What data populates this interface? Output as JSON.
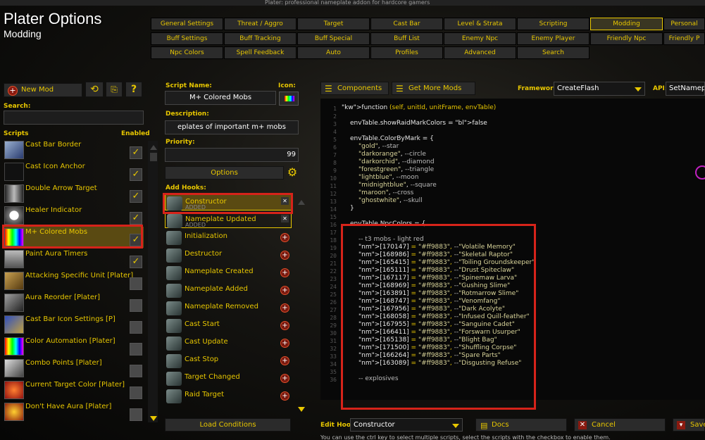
{
  "top_strip": "Plater: professional nameplate addon for hardcore gamers",
  "app": {
    "title": "Plater Options",
    "subtitle": "Modding"
  },
  "tabs": [
    [
      "General Settings",
      "Threat / Aggro",
      "Target",
      "Cast Bar",
      "Level & Strata",
      "Scripting",
      "Modding",
      "Personal"
    ],
    [
      "Buff Settings",
      "Buff Tracking",
      "Buff Special",
      "Buff List",
      "Enemy Npc",
      "Enemy Player",
      "Friendly Npc",
      "Friendly P"
    ],
    [
      "Npc Colors",
      "Spell Feedback",
      "Auto",
      "Profiles",
      "Advanced",
      "Search"
    ]
  ],
  "left": {
    "new_mod": "New Mod",
    "search_label": "Search:",
    "scripts_label": "Scripts",
    "enabled_label": "Enabled",
    "scripts": [
      {
        "name": "Cast Bar Border",
        "enabled": true
      },
      {
        "name": "Cast Icon Anchor",
        "enabled": true
      },
      {
        "name": "Double Arrow Target",
        "enabled": true
      },
      {
        "name": "Healer Indicator",
        "enabled": true
      },
      {
        "name": "M+ Colored Mobs",
        "enabled": true
      },
      {
        "name": "Paint Aura Timers",
        "enabled": true
      },
      {
        "name": "Attacking Specific Unit [Plater]",
        "enabled": false
      },
      {
        "name": "Aura Reorder [Plater]",
        "enabled": false
      },
      {
        "name": "Cast Bar Icon Settings [P]",
        "enabled": false
      },
      {
        "name": "Color Automation [Plater]",
        "enabled": false
      },
      {
        "name": "Combo Points [Plater]",
        "enabled": false
      },
      {
        "name": "Current Target Color [Plater]",
        "enabled": false
      },
      {
        "name": "Don't Have Aura [Plater]",
        "enabled": false
      }
    ],
    "check_glyph": "✓"
  },
  "middle": {
    "script_name_label": "Script Name:",
    "script_name": "M+ Colored Mobs",
    "icon_label": "Icon:",
    "description_label": "Description:",
    "description": "eplates of important m+ mobs",
    "priority_label": "Priority:",
    "priority": "99",
    "options": "Options",
    "add_hooks_label": "Add Hooks:",
    "hooks": [
      {
        "name": "Constructor",
        "sub": "ADDED"
      },
      {
        "name": "Nameplate Updated",
        "sub": "ADDED"
      },
      {
        "name": "Initialization"
      },
      {
        "name": "Destructor"
      },
      {
        "name": "Nameplate Created"
      },
      {
        "name": "Nameplate Added"
      },
      {
        "name": "Nameplate Removed"
      },
      {
        "name": "Cast Start"
      },
      {
        "name": "Cast Update"
      },
      {
        "name": "Cast Stop"
      },
      {
        "name": "Target Changed"
      },
      {
        "name": "Raid Target"
      }
    ],
    "load_conditions": "Load Conditions"
  },
  "right": {
    "components": "Components",
    "get_more_mods": "Get More Mods",
    "framework_label": "Framework:",
    "framework": "CreateFlash",
    "api_label": "API:",
    "api": "SetNameplat",
    "edit_hook_label": "Edit Hook:",
    "edit_hook": "Constructor",
    "docs": "Docs",
    "cancel": "Cancel",
    "save": "Save"
  },
  "code": {
    "line_numbers": [
      "1",
      "2",
      "3",
      "4",
      "5",
      "6",
      "7",
      "8",
      "9",
      "10",
      "11",
      "12",
      "13",
      "14",
      "15",
      "16",
      "17",
      "18",
      "19",
      "20",
      "21",
      "22",
      "23",
      "24",
      "25",
      "26",
      "27",
      "28",
      "29",
      "30",
      "31",
      "32",
      "33",
      "34",
      "35",
      "36"
    ],
    "lines": [
      [
        "function (self, unitId, unitFrame, envTable)"
      ],
      [
        "envTable.showRaidMarkColors = false"
      ],
      [
        "envTable.ColorByMark = {"
      ],
      [
        "\"gold\", --star"
      ],
      [
        "\"darkorange\", --circle"
      ],
      [
        "\"darkorchid\", --diamond"
      ],
      [
        "\"forestgreen\", --triangle"
      ],
      [
        "\"lightblue\", --moon"
      ],
      [
        "\"midnightblue\", --square"
      ],
      [
        "\"maroon\", --cross"
      ],
      [
        "\"ghostwhite\", --skull"
      ],
      [
        "}"
      ],
      [
        "envTable.NpcColors = {"
      ],
      [
        "-- t3 mobs - light red"
      ],
      [
        "[170147] = \"#ff9883\", --\"Volatile Memory\""
      ],
      [
        "[168986] = \"#ff9883\", --\"Skeletal Raptor\""
      ],
      [
        "[165415] = \"#ff9883\", --\"Toiling Groundskeeper\""
      ],
      [
        "[165111] = \"#ff9883\", --\"Drust Spiteclaw\""
      ],
      [
        "[167117] = \"#ff9883\", --\"Spinemaw Larva\""
      ],
      [
        "[168969] = \"#ff9883\", --\"Gushing Slime\""
      ],
      [
        "[163891] = \"#ff9883\", --\"Rotmarrow Slime\""
      ],
      [
        "[168747] = \"#ff9883\", --\"Venomfang\""
      ],
      [
        "[167956] = \"#ff9883\", --\"Dark Acolyte\""
      ],
      [
        "[168058] = \"#ff9883\", --\"Infused Quill-feather\""
      ],
      [
        "[167955] = \"#ff9883\", --\"Sanguine Cadet\""
      ],
      [
        "[166411] = \"#ff9883\", --\"Forswarn Usurper\""
      ],
      [
        "[165138] = \"#ff9883\", --\"Blight Bag\""
      ],
      [
        "[171500] = \"#ff9883\", --\"Shuffling Corpse\""
      ],
      [
        "[166264] = \"#ff9883\", --\"Spare Parts\""
      ],
      [
        "[163089] = \"#ff9883\", --\"Disgusting Refuse\""
      ],
      [
        "-- explosives"
      ]
    ]
  },
  "bottom_hint": "You can use the ctrl key to select multiple scripts, select the scripts with the checkbox to enable them."
}
